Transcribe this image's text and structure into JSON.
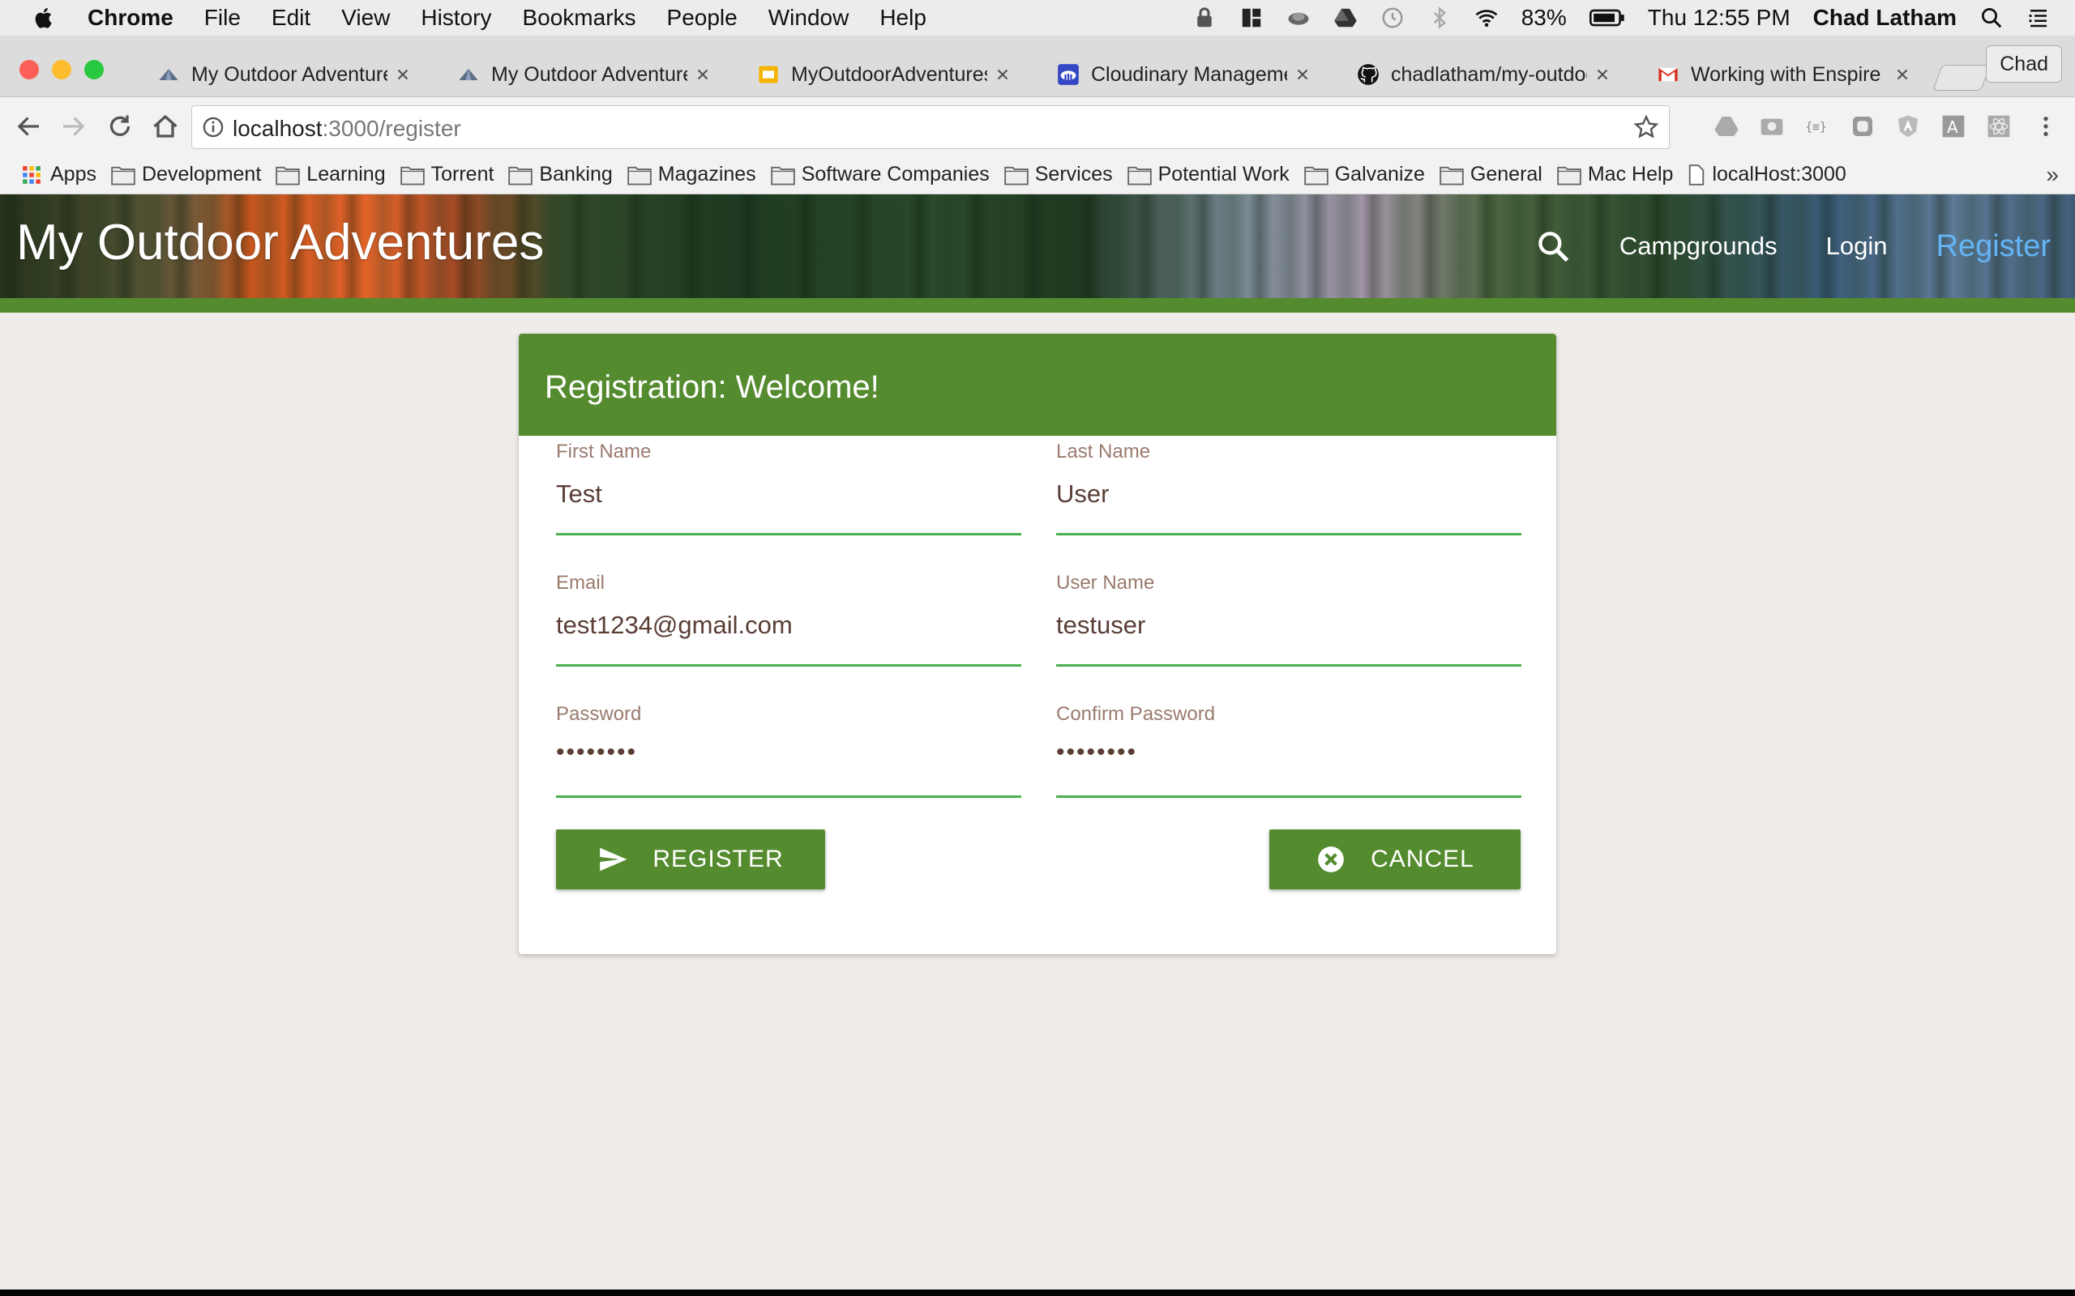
{
  "menubar": {
    "app": "Chrome",
    "items": [
      "File",
      "Edit",
      "View",
      "History",
      "Bookmarks",
      "People",
      "Window",
      "Help"
    ],
    "battery": "83%",
    "clock": "Thu 12:55 PM",
    "user": "Chad Latham"
  },
  "tabs": [
    {
      "label": "My Outdoor Adventures",
      "icon": "tent-icon"
    },
    {
      "label": "My Outdoor Adventures",
      "icon": "tent-icon"
    },
    {
      "label": "MyOutdoorAdventures",
      "icon": "slides-icon"
    },
    {
      "label": "Cloudinary Management",
      "icon": "cloudinary-icon"
    },
    {
      "label": "chadlatham/my-outdoor",
      "icon": "github-icon"
    },
    {
      "label": "Working with Enspire",
      "icon": "gmail-icon"
    }
  ],
  "profile": "Chad",
  "omnibox": {
    "host": "localhost",
    "path": ":3000/register"
  },
  "bookmarks": [
    "Apps",
    "Development",
    "Learning",
    "Torrent",
    "Banking",
    "Magazines",
    "Software Companies",
    "Services",
    "Potential Work",
    "Galvanize",
    "General",
    "Mac Help",
    "localHost:3000"
  ],
  "bookmarks_more": "»",
  "site": {
    "brand": "My Outdoor Adventures",
    "nav": [
      "Campgrounds",
      "Login",
      "Register"
    ]
  },
  "form": {
    "title": "Registration: Welcome!",
    "first_name": {
      "label": "First Name",
      "value": "Test"
    },
    "last_name": {
      "label": "Last Name",
      "value": "User"
    },
    "email": {
      "label": "Email",
      "value": "test1234@gmail.com"
    },
    "user_name": {
      "label": "User Name",
      "value": "testuser"
    },
    "password": {
      "label": "Password",
      "value": "••••••••"
    },
    "confirm_password": {
      "label": "Confirm Password",
      "value": "••••••••"
    },
    "register_label": "REGISTER",
    "cancel_label": "CANCEL"
  },
  "colors": {
    "accent": "#558b2f",
    "underline": "#4caf50",
    "active_nav": "#64b5f6",
    "page_bg": "#f0ecea"
  }
}
